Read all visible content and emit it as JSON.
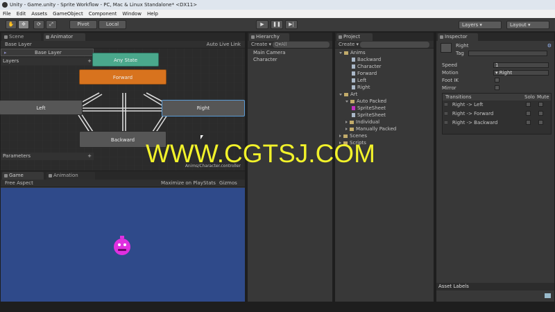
{
  "window": {
    "title": "Unity - Game.unity - Sprite Workflow - PC, Mac & Linux Standalone* <DX11>"
  },
  "menu": [
    "File",
    "Edit",
    "Assets",
    "GameObject",
    "Component",
    "Window",
    "Help"
  ],
  "toolbar": {
    "pivot_label": "Pivot",
    "local_label": "Local",
    "layers_label": "Layers",
    "layout_label": "Layout"
  },
  "animator": {
    "tabs": {
      "scene": "Scene",
      "animator": "Animator"
    },
    "breadcrumb": "Base Layer",
    "auto_live_link": "Auto Live Link",
    "layers_header": "Layers",
    "layer_name": "Base Layer",
    "parameters_header": "Parameters",
    "add_label": "+",
    "controller_path": "Anims/Character.controller",
    "states": {
      "any_state": "Any State",
      "forward": "Forward",
      "left": "Left",
      "right": "Right",
      "backward": "Backward"
    }
  },
  "hierarchy": {
    "tab": "Hierarchy",
    "create_label": "Create",
    "search_placeholder": "Q▾All",
    "items": [
      "Main Camera",
      "Character"
    ]
  },
  "project": {
    "tab": "Project",
    "create_label": "Create",
    "items": [
      {
        "label": "Anims",
        "kind": "folder",
        "indent": 0
      },
      {
        "label": "Backward",
        "kind": "file",
        "indent": 2
      },
      {
        "label": "Character",
        "kind": "file",
        "indent": 2
      },
      {
        "label": "Forward",
        "kind": "file",
        "indent": 2
      },
      {
        "label": "Left",
        "kind": "file",
        "indent": 2
      },
      {
        "label": "Right",
        "kind": "file",
        "indent": 2
      },
      {
        "label": "Art",
        "kind": "folder",
        "indent": 0
      },
      {
        "label": "Auto Packed",
        "kind": "folder",
        "indent": 1
      },
      {
        "label": "SpriteSheet",
        "kind": "sprite",
        "indent": 2
      },
      {
        "label": "SpriteSheet",
        "kind": "file",
        "indent": 2
      },
      {
        "label": "Individual",
        "kind": "folder",
        "indent": 1
      },
      {
        "label": "Manually Packed",
        "kind": "folder",
        "indent": 1
      },
      {
        "label": "Scenes",
        "kind": "folder",
        "indent": 0
      },
      {
        "label": "Scripts",
        "kind": "folder",
        "indent": 0
      }
    ]
  },
  "inspector": {
    "tab": "Inspector",
    "object_name": "Right",
    "tag_label": "Tag",
    "fields": [
      {
        "label": "Speed",
        "value": "1"
      },
      {
        "label": "Motion",
        "value": "Right"
      },
      {
        "label": "Foot IK",
        "value": ""
      },
      {
        "label": "Mirror",
        "value": ""
      }
    ],
    "transitions_header": "Transitions",
    "solo_label": "Solo",
    "mute_label": "Mute",
    "transitions": [
      "Right -> Left",
      "Right -> Forward",
      "Right -> Backward"
    ],
    "asset_labels": "Asset Labels"
  },
  "game": {
    "tabs": {
      "game": "Game",
      "animation": "Animation"
    },
    "aspect": "Free Aspect",
    "maximize": "Maximize on Play",
    "stats": "Stats",
    "gizmos": "Gizmos"
  },
  "watermark": "WWW.CGTSJ.COM",
  "colors": {
    "forward_state": "#d8731e",
    "any_state": "#4aa88c",
    "selected_state_border": "#5b9bd5",
    "game_bg": "#2f4a8a",
    "character": "#e030e0",
    "watermark": "#f2f22a"
  }
}
